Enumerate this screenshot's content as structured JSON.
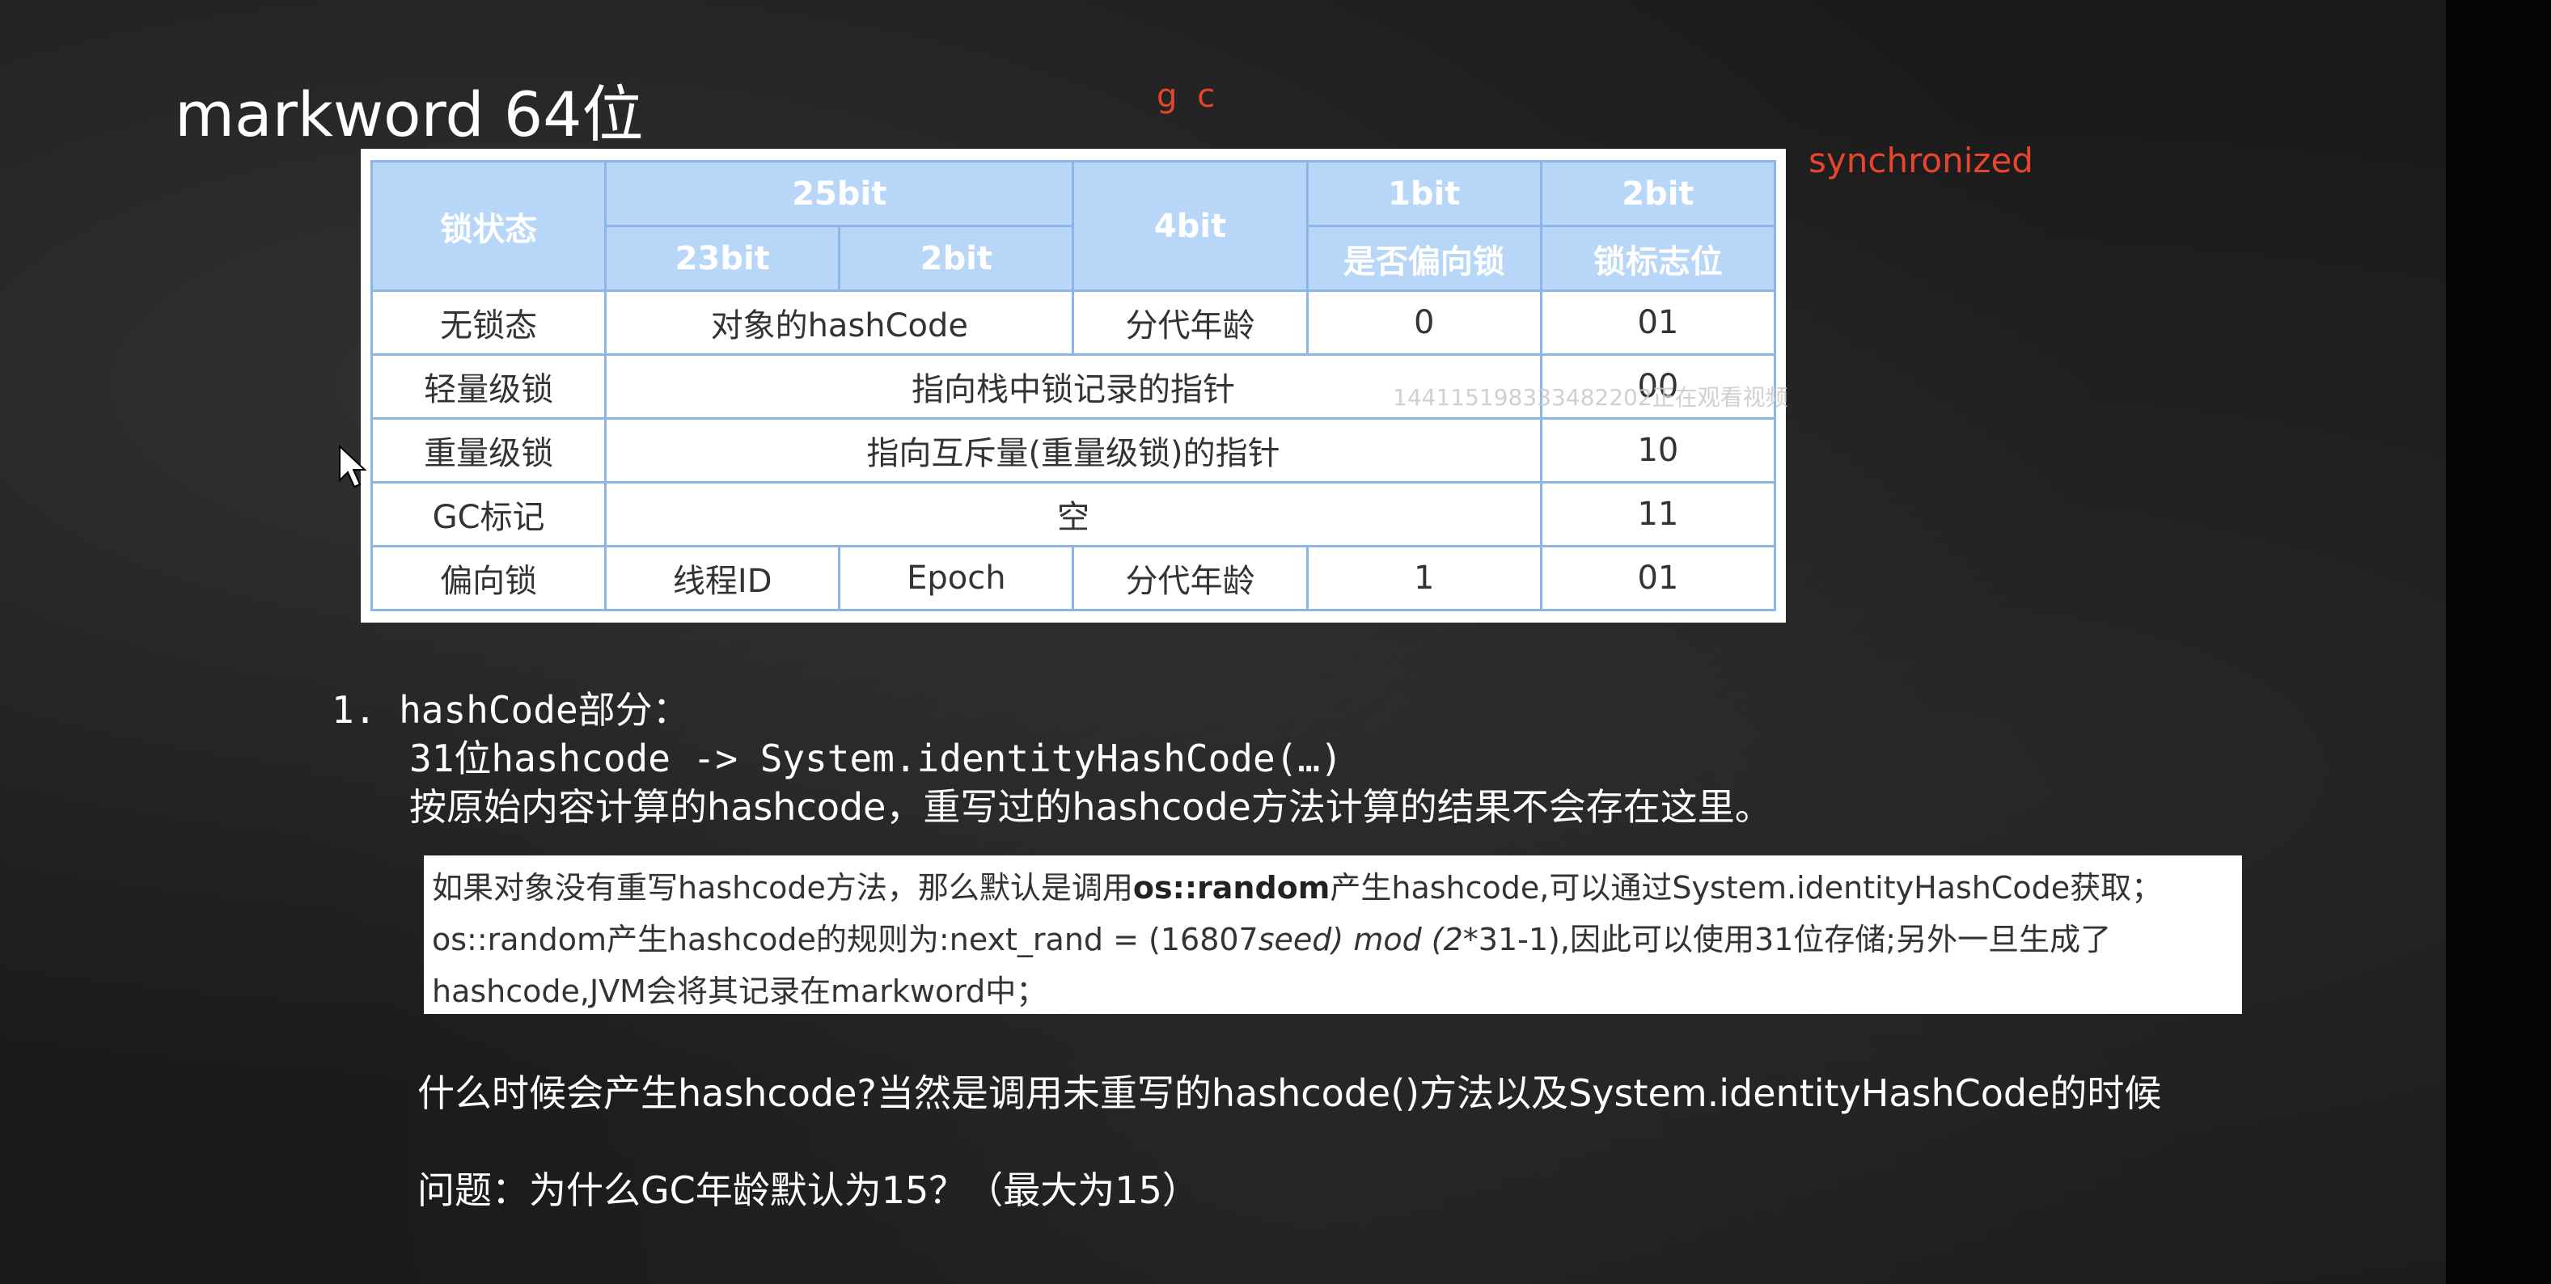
{
  "slide": {
    "title": "markword 64位",
    "annotation_gc": "g c",
    "annotation_sync": "synchronized",
    "watermark": "144115198333482202正在观看视频"
  },
  "lock_table": {
    "header_row1": [
      "锁状态",
      "25bit",
      "4bit",
      "1bit",
      "2bit"
    ],
    "header_row2": [
      "23bit",
      "2bit",
      "是否偏向锁",
      "锁标志位"
    ],
    "rows": [
      {
        "state": "无锁态",
        "hash": "对象的hashCode",
        "age": "分代年龄",
        "biased": "0",
        "flag": "01"
      },
      {
        "state": "轻量级锁",
        "pointer": "指向栈中锁记录的指针",
        "flag": "00"
      },
      {
        "state": "重量级锁",
        "pointer": "指向互斥量(重量级锁)的指针",
        "flag": "10"
      },
      {
        "state": "GC标记",
        "pointer": "空",
        "flag": "11"
      },
      {
        "state": "偏向锁",
        "thread": "线程ID",
        "epoch": "Epoch",
        "age": "分代年龄",
        "biased": "1",
        "flag": "01"
      }
    ]
  },
  "notes": {
    "line1": "1. hashCode部分：",
    "line2": "31位hashcode -> System.identityHashCode(…)",
    "line3": "按原始内容计算的hashcode，重写过的hashcode方法计算的结果不会存在这里。",
    "box": {
      "l1_a": "如果对象没有重写hashcode方法，那么默认是调用",
      "l1_bold": "os::random",
      "l1_b": "产生hashcode,可以通过System.identityHashCode获取；",
      "l2_a": "os::random产生hashcode的规则为:next_rand = (16807",
      "l2_i1": "seed) mod (2",
      "l2_b": "*31-1),因此可以使用31位存储;另外一旦生成了",
      "l3": "hashcode,JVM会将其记录在markword中；"
    },
    "question1": "什么时候会产生hashcode?当然是调用未重写的hashcode()方法以及System.identityHashCode的时候",
    "question2": "问题：为什么GC年龄默认为15？（最大为15）"
  }
}
